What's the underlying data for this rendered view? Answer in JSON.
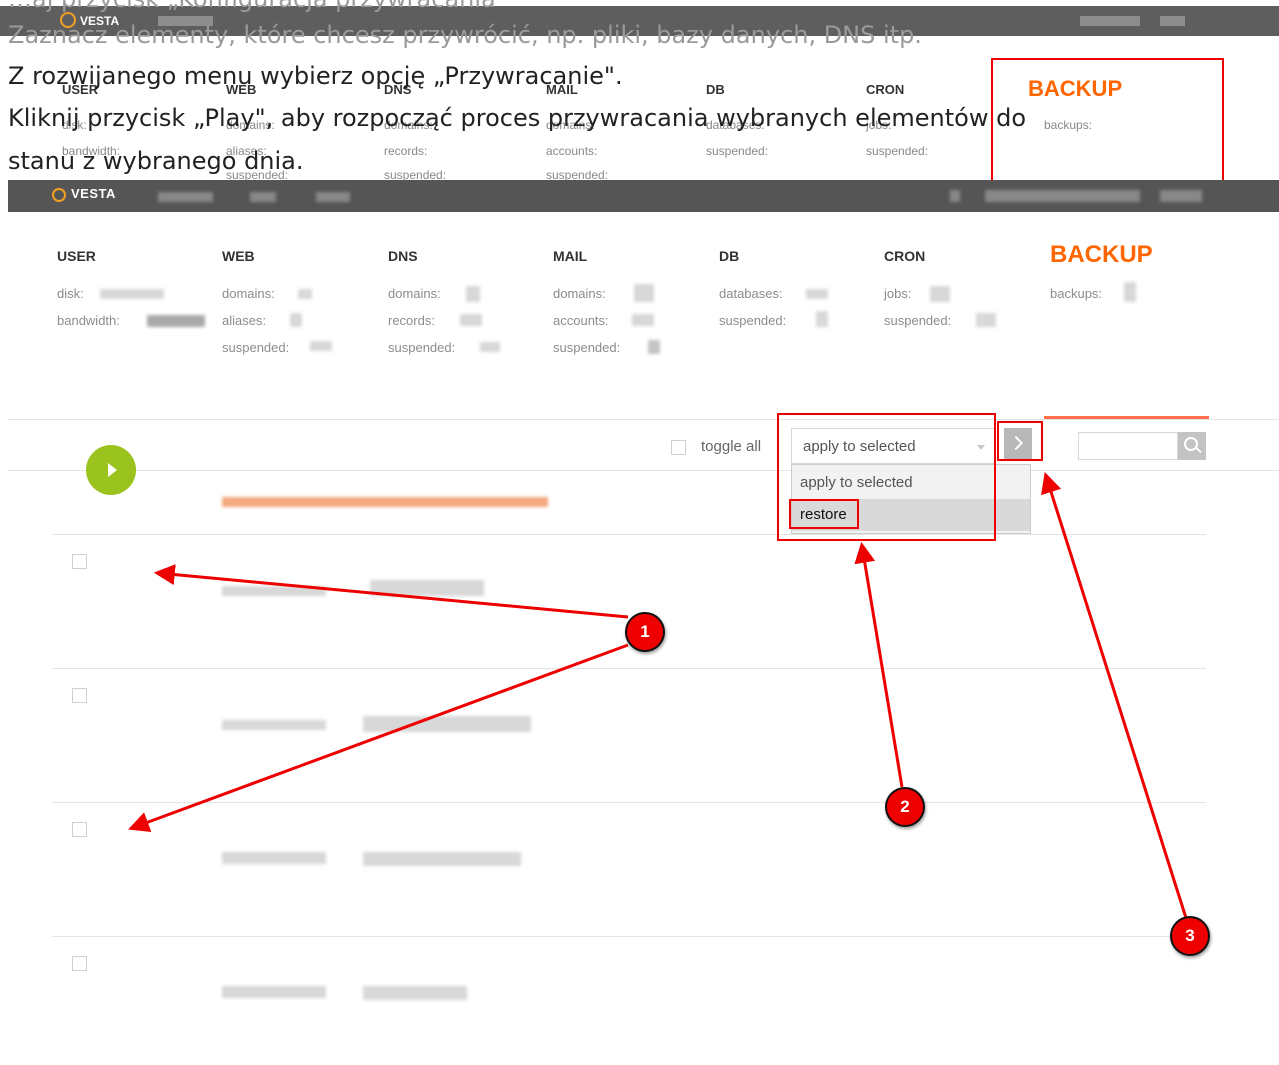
{
  "ghost": {
    "logo": "VESTA",
    "headers": [
      "USER",
      "WEB",
      "DNS",
      "MAIL",
      "DB",
      "CRON",
      "BACKUP"
    ],
    "stats": {
      "user": [
        "disk:",
        "bandwidth:"
      ],
      "web": [
        "domains:",
        "aliases:",
        "suspended:"
      ],
      "dns": [
        "domains:",
        "records:",
        "suspended:"
      ],
      "mail": [
        "domains:",
        "accounts:",
        "suspended:"
      ],
      "db": [
        "databases:",
        "suspended:"
      ],
      "cron": [
        "jobs:",
        "suspended:"
      ],
      "backup": [
        "backups:"
      ]
    }
  },
  "instructions": {
    "line0": "…aj przycisk „Konfiguracja przywracania\"",
    "line1": "Zaznacz elementy, które chcesz przywrócić, np. pliki, bazy danych, DNS itp.",
    "line2": "Z rozwijanego menu wybierz opcję „Przywracanie\".",
    "line3": "Kliknij przycisk „Play\", aby rozpocząć proces przywracania wybranych elementów do",
    "line4": "stanu z wybranego dnia."
  },
  "app": {
    "logo": "VESTA",
    "nav": {
      "user": {
        "label": "USER",
        "stats": [
          "disk:",
          "bandwidth:"
        ]
      },
      "web": {
        "label": "WEB",
        "stats": [
          "domains:",
          "aliases:",
          "suspended:"
        ]
      },
      "dns": {
        "label": "DNS",
        "stats": [
          "domains:",
          "records:",
          "suspended:"
        ]
      },
      "mail": {
        "label": "MAIL",
        "stats": [
          "domains:",
          "accounts:",
          "suspended:"
        ]
      },
      "db": {
        "label": "DB",
        "stats": [
          "databases:",
          "suspended:"
        ]
      },
      "cron": {
        "label": "CRON",
        "stats": [
          "jobs:",
          "suspended:"
        ]
      },
      "backup": {
        "label": "BACKUP",
        "stats": [
          "backups:"
        ]
      }
    },
    "toolbar": {
      "toggle_all": "toggle all",
      "select_value": "apply to selected",
      "options": [
        "apply to selected",
        "restore"
      ],
      "search_placeholder": ""
    }
  },
  "annotations": [
    "1",
    "2",
    "3"
  ],
  "colors": {
    "accent": "#ff6600",
    "play": "#9bc31d",
    "annotation": "#ee0000",
    "topbar": "#555555"
  }
}
